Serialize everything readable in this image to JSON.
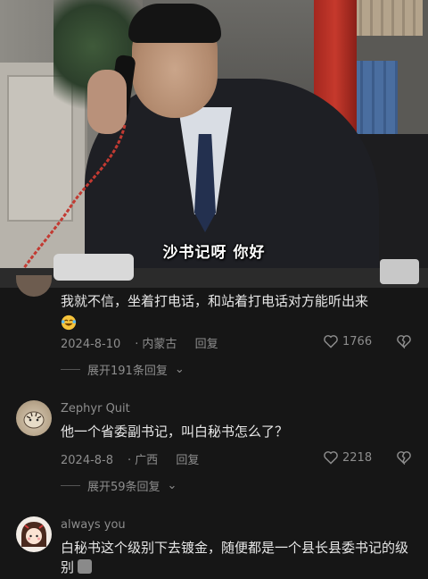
{
  "video": {
    "subtitle": "沙书记呀 你好"
  },
  "comments": [
    {
      "username": "",
      "text": "我就不信，坐着打电话，和站着打电话对方能听出来",
      "emoji": "laughing-crying-emoji",
      "date": "2024-8-10",
      "location": "内蒙古",
      "reply_label": "回复",
      "likes": "1766",
      "expand_label": "展开191条回复"
    },
    {
      "username": "Zephyr Quit",
      "text": "他一个省委副书记，叫白秘书怎么了？",
      "date": "2024-8-8",
      "location": "广西",
      "reply_label": "回复",
      "likes": "2218",
      "expand_label": "展开59条回复"
    },
    {
      "username": "always you",
      "text": "白秘书这个级别下去镀金，随便都是一个县长县委书记的级别",
      "emoji_trailing": "crying-emoji"
    }
  ],
  "colors": {
    "background": "#161616",
    "meta_text": "#8d8d8d",
    "body_text": "#e6e6e6"
  }
}
